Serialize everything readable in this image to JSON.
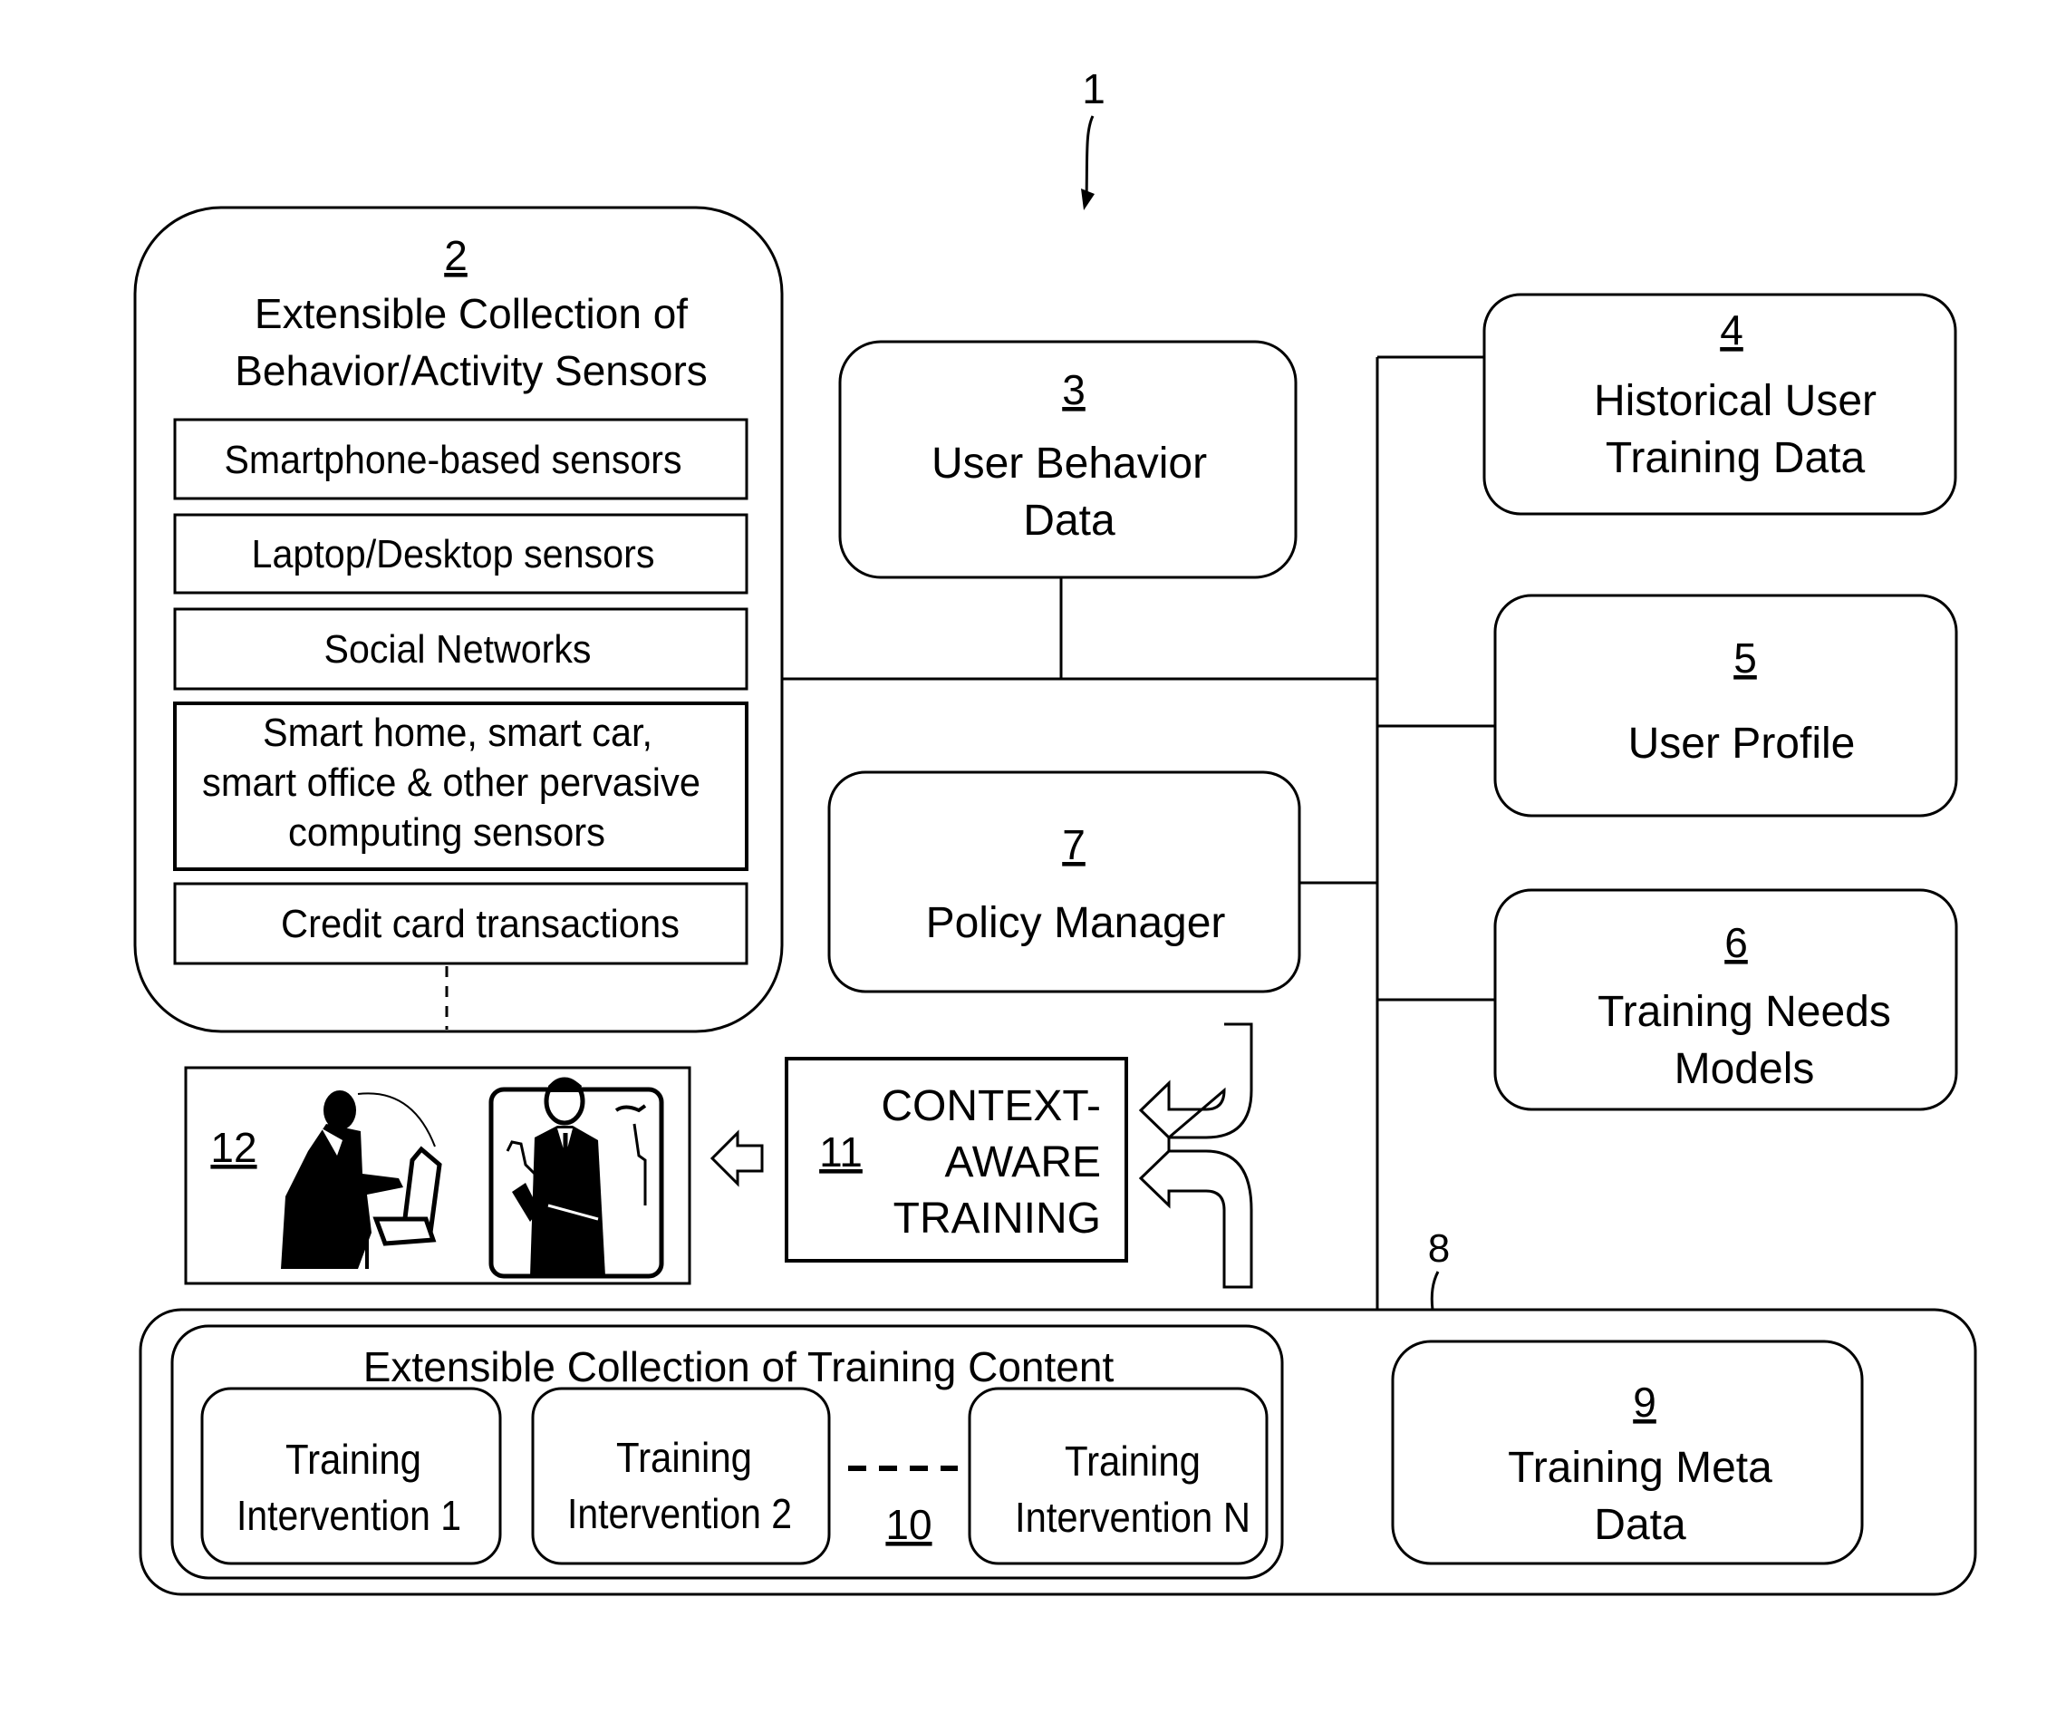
{
  "figure_ref": "1",
  "blocks": {
    "sensors": {
      "ref": "2",
      "title_line1": "Extensible Collection of",
      "title_line2": "Behavior/Activity Sensors",
      "items": [
        {
          "lines": [
            "Smartphone-based sensors"
          ]
        },
        {
          "lines": [
            "Laptop/Desktop sensors"
          ]
        },
        {
          "lines": [
            "Social Networks"
          ]
        },
        {
          "lines": [
            "Smart home, smart car,",
            "smart office & other pervasive",
            "computing sensors"
          ]
        },
        {
          "lines": [
            "Credit card transactions"
          ]
        }
      ]
    },
    "user_behavior": {
      "ref": "3",
      "line1": "User Behavior",
      "line2": "Data"
    },
    "historical": {
      "ref": "4",
      "line1": "Historical User",
      "line2": "Training Data"
    },
    "user_profile": {
      "ref": "5",
      "line1": "User Profile"
    },
    "needs_models": {
      "ref": "6",
      "line1": "Training Needs",
      "line2": "Models"
    },
    "policy_manager": {
      "ref": "7",
      "line1": "Policy Manager"
    },
    "bus_ref": "8",
    "meta_data": {
      "ref": "9",
      "line1": "Training Meta",
      "line2": "Data"
    },
    "training_content": {
      "ref": "10",
      "title": "Extensible Collection of Training Content",
      "interventions": [
        {
          "line1": "Training",
          "line2": "Intervention 1"
        },
        {
          "line1": "Training",
          "line2": "Intervention 2"
        },
        {
          "line1": "Training",
          "line2": "Intervention N"
        }
      ]
    },
    "context_aware": {
      "ref": "11",
      "line1": "CONTEXT-",
      "line2": "AWARE",
      "line3": "TRAINING"
    },
    "delivery": {
      "ref": "12",
      "illustrations": [
        "person-at-laptop-icon",
        "businessman-with-phone-icon"
      ]
    }
  }
}
